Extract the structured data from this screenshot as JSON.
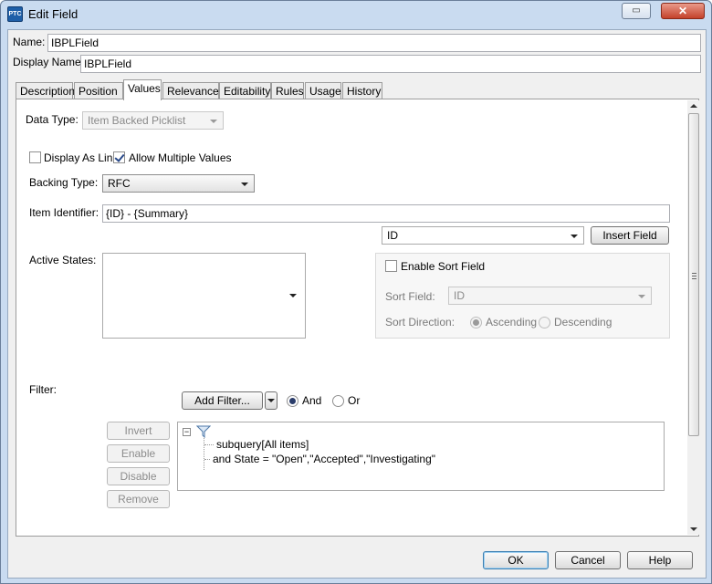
{
  "window": {
    "title": "Edit Field",
    "app_icon_text": "PTC",
    "close_glyph": "✕",
    "restore_glyph": "▭"
  },
  "form": {
    "name_label": "Name:",
    "name_value": "IBPLField",
    "display_name_label": "Display Name:",
    "display_name_value": "IBPLField"
  },
  "tabs": [
    "Description",
    "Position",
    "Values",
    "Relevance",
    "Editability",
    "Rules",
    "Usage",
    "History"
  ],
  "active_tab": "Values",
  "values_panel": {
    "data_type_label": "Data Type:",
    "data_type_value": "Item Backed Picklist",
    "display_as_link_label": "Display As Link",
    "display_as_link_checked": false,
    "allow_multiple_label": "Allow Multiple Values",
    "allow_multiple_checked": true,
    "backing_type_label": "Backing Type:",
    "backing_type_value": "RFC",
    "item_identifier_label": "Item Identifier:",
    "item_identifier_value": "{ID} - {Summary}",
    "field_select_value": "ID",
    "insert_field_label": "Insert Field",
    "active_states_label": "Active States:",
    "enable_sort_label": "Enable Sort Field",
    "enable_sort_checked": false,
    "sort_field_label": "Sort Field:",
    "sort_field_value": "ID",
    "sort_direction_label": "Sort Direction:",
    "ascending_label": "Ascending",
    "descending_label": "Descending",
    "filter_label": "Filter:",
    "add_filter_label": "Add Filter...",
    "and_label": "And",
    "or_label": "Or",
    "filter_buttons": {
      "invert": "Invert",
      "enable": "Enable",
      "disable": "Disable",
      "remove": "Remove"
    },
    "filter_tree": {
      "node1": "subquery[All items]",
      "node2": "and State = \"Open\",\"Accepted\",\"Investigating\""
    }
  },
  "footer": {
    "ok_label": "OK",
    "cancel_label": "Cancel",
    "help_label": "Help"
  }
}
